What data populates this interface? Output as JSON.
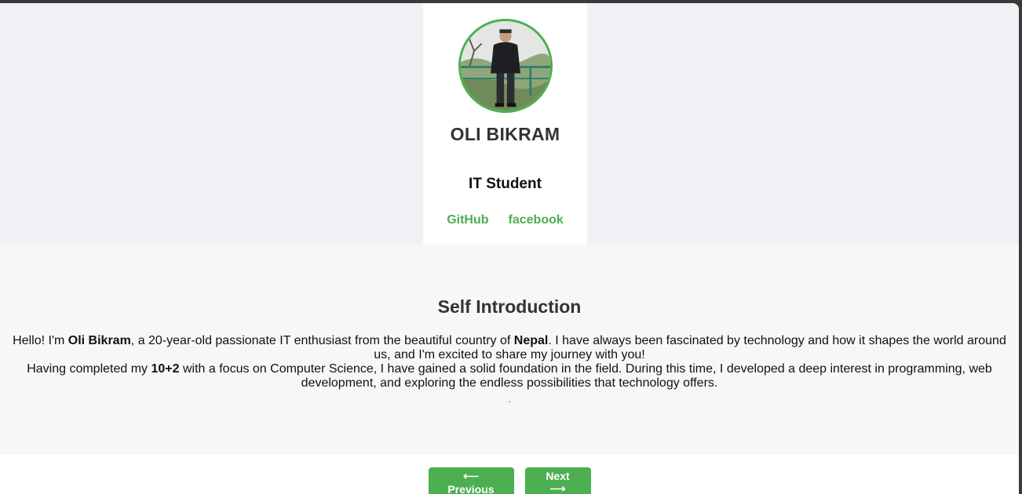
{
  "profile": {
    "name": "OLI BIKRAM",
    "role": "IT Student",
    "links": [
      {
        "label": "GitHub"
      },
      {
        "label": "facebook"
      }
    ]
  },
  "intro": {
    "heading": "Self Introduction",
    "p1": {
      "t1": "Hello! I'm ",
      "b1": "Oli Bikram",
      "t2": ", a 20-year-old passionate IT enthusiast from the beautiful country of ",
      "b2": "Nepal",
      "t3": ". I have always been fascinated by technology and how it shapes the world around us, and I'm excited to share my journey with you!"
    },
    "p2": {
      "t1": "Having completed my ",
      "b1": "10+2",
      "t2": " with a focus on Computer Science, I have gained a solid foundation in the field. During this time, I developed a deep interest in programming, web development, and exploring the endless possibilities that technology offers."
    },
    "trailing": "."
  },
  "nav": {
    "previous": "⟵ Previous",
    "next": "Next ⟶"
  },
  "colors": {
    "accent": "#4caf50",
    "hero_bg": "#f0f1f5",
    "intro_bg": "#f7f7f7"
  }
}
